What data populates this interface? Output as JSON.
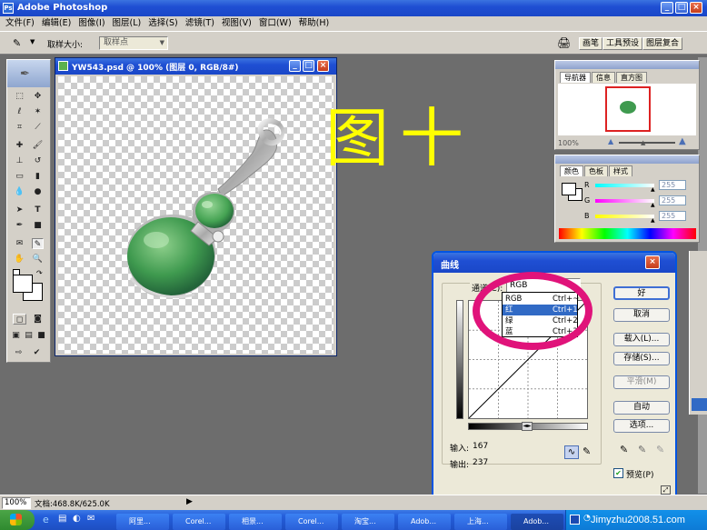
{
  "app": {
    "title": "Adobe Photoshop"
  },
  "menu": [
    "文件(F)",
    "编辑(E)",
    "图像(I)",
    "图层(L)",
    "选择(S)",
    "滤镜(T)",
    "视图(V)",
    "窗口(W)",
    "帮助(H)"
  ],
  "options_bar": {
    "label": "取样大小:",
    "value": "取样点"
  },
  "palette_well": {
    "tabs": [
      "画笔",
      "工具预设",
      "图层复合"
    ]
  },
  "document": {
    "title": "YW543.psd @ 100% (图层 0, RGB/8#)"
  },
  "overlay_caption": "图十",
  "navigator": {
    "tabs": [
      "导航器",
      "信息",
      "直方图"
    ],
    "zoom": "100%"
  },
  "color_panel": {
    "tabs": [
      "颜色",
      "色板",
      "样式"
    ],
    "channels": [
      {
        "label": "R",
        "value": "255",
        "color": "#ff2a2a"
      },
      {
        "label": "G",
        "value": "255",
        "color": "#2aff2a"
      },
      {
        "label": "B",
        "value": "255",
        "color": "#ffff2a"
      }
    ]
  },
  "curves": {
    "title": "曲线",
    "channel_label": "通道(C):",
    "channel_value": "RGB",
    "dropdown": [
      {
        "name": "RGB",
        "shortcut": "Ctrl+~",
        "selected": false
      },
      {
        "name": "红",
        "shortcut": "Ctrl+1",
        "selected": true
      },
      {
        "name": "绿",
        "shortcut": "Ctrl+2",
        "selected": false
      },
      {
        "name": "蓝",
        "shortcut": "Ctrl+3",
        "selected": false
      }
    ],
    "buttons": {
      "ok": "好",
      "cancel": "取消",
      "load": "载入(L)...",
      "save": "存储(S)...",
      "smooth": "平滑(M)",
      "auto": "自动",
      "options": "选项..."
    },
    "input_label": "输入:",
    "input_value": "167",
    "output_label": "输出:",
    "output_value": "237",
    "preview_label": "预览(P)",
    "preview_checked": true
  },
  "status_bar": {
    "zoom": "100%",
    "doc_info": "文档:468.8K/625.0K"
  },
  "taskbar": {
    "items": [
      "阿里...",
      "Corel...",
      "相景...",
      "Corel...",
      "淘宝...",
      "Adob...",
      "上海...",
      "Adob..."
    ],
    "watermark": "Jimyzhu2008.51.com"
  }
}
